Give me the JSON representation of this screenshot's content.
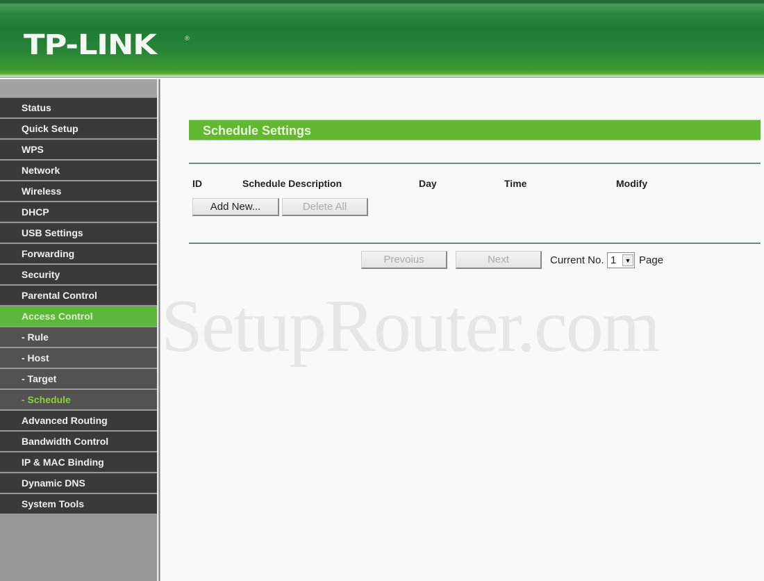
{
  "header": {
    "logo": "TP-LINK",
    "logo_mark": "®"
  },
  "sidebar": {
    "items": [
      {
        "label": "Status",
        "type": "main",
        "state": "normal"
      },
      {
        "label": "Quick Setup",
        "type": "main",
        "state": "normal"
      },
      {
        "label": "WPS",
        "type": "main",
        "state": "normal"
      },
      {
        "label": "Network",
        "type": "main",
        "state": "normal"
      },
      {
        "label": "Wireless",
        "type": "main",
        "state": "normal"
      },
      {
        "label": "DHCP",
        "type": "main",
        "state": "normal"
      },
      {
        "label": "USB Settings",
        "type": "main",
        "state": "normal"
      },
      {
        "label": "Forwarding",
        "type": "main",
        "state": "normal"
      },
      {
        "label": "Security",
        "type": "main",
        "state": "normal"
      },
      {
        "label": "Parental Control",
        "type": "main",
        "state": "normal"
      },
      {
        "label": "Access Control",
        "type": "main",
        "state": "active"
      },
      {
        "label": "- Rule",
        "type": "sub",
        "state": "normal"
      },
      {
        "label": "- Host",
        "type": "sub",
        "state": "normal"
      },
      {
        "label": "- Target",
        "type": "sub",
        "state": "normal"
      },
      {
        "label": "- Schedule",
        "type": "sub",
        "state": "active"
      },
      {
        "label": "Advanced Routing",
        "type": "main",
        "state": "normal"
      },
      {
        "label": "Bandwidth Control",
        "type": "main",
        "state": "normal"
      },
      {
        "label": "IP & MAC Binding",
        "type": "main",
        "state": "normal"
      },
      {
        "label": "Dynamic DNS",
        "type": "main",
        "state": "normal"
      },
      {
        "label": "System Tools",
        "type": "main",
        "state": "normal"
      }
    ]
  },
  "main": {
    "title": "Schedule Settings",
    "table": {
      "columns": [
        "ID",
        "Schedule Description",
        "Day",
        "Time",
        "Modify"
      ],
      "rows": []
    },
    "buttons": {
      "add_new": "Add New...",
      "delete_all": "Delete All",
      "previous": "Prevoius",
      "next": "Next"
    },
    "pagination": {
      "current_label": "Current No.",
      "current_value": "1",
      "page_label": "Page"
    }
  },
  "watermark": "SetupRouter.com",
  "colors": {
    "brand_green": "#1f7a35",
    "accent_green": "#63b832",
    "menu_dark": "#3a3a3a",
    "menu_sub": "#525252",
    "active_sub_text": "#8fcf40"
  }
}
